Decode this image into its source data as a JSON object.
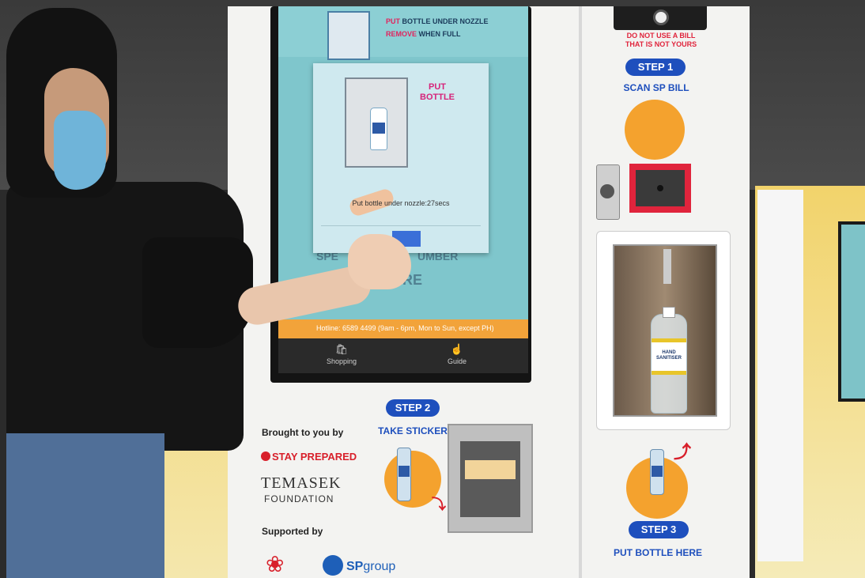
{
  "screen": {
    "top_line_1_accent": "PUT",
    "top_line_1_rest": "BOTTLE UNDER NOZZLE",
    "top_line_2_accent": "REMOVE",
    "top_line_2_rest": "WHEN FULL",
    "behind_text_1": "SPE",
    "behind_text_2": "UMBER",
    "behind_text_3": "HERE",
    "hotline": "Hotline: 6589 4499 (9am - 6pm, Mon to Sun, except PH)",
    "nav": [
      {
        "label": "Shopping",
        "icon": "bag-icon"
      },
      {
        "label": "Guide",
        "icon": "hand-pointer-icon"
      }
    ]
  },
  "dialog": {
    "title_line_1": "PUT",
    "title_line_2": "BOTTLE",
    "message": "Put bottle under nozzle:27secs"
  },
  "machine": {
    "warning_line_1": "DO NOT USE A BILL",
    "warning_line_2": "THAT IS NOT YOURS",
    "step1_label": "STEP 1",
    "step1_caption": "SCAN SP BILL",
    "step2_label": "STEP 2",
    "step2_caption": "TAKE STICKER",
    "step3_label": "STEP 3",
    "step3_caption": "PUT BOTTLE HERE",
    "bottle_label_line_1": "HAND",
    "bottle_label_line_2": "SANITISER"
  },
  "sponsors": {
    "brought_by": "Brought to you by",
    "stay_prepared": "STAY PREPARED",
    "temasek": "TEMASEK",
    "foundation": "FOUNDATION",
    "supported_by": "Supported by",
    "sp_group_a": "SP",
    "sp_group_b": "group"
  },
  "colors": {
    "step_blue": "#1e4fbd",
    "warning_red": "#e0243c",
    "accent_orange": "#f4a22e",
    "screen_teal": "#7fc6cc"
  }
}
